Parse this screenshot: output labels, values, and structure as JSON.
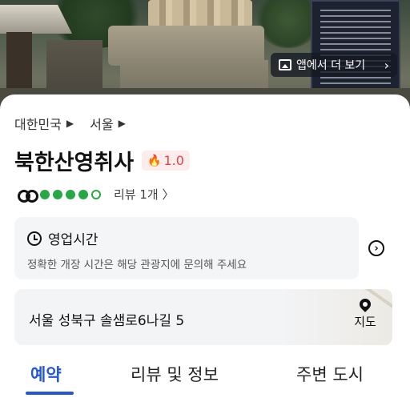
{
  "hero": {
    "app_button_label": "앱에서 더 보기",
    "app_button_chevron": "›"
  },
  "breadcrumb": {
    "items": [
      "대한민국",
      "서울"
    ],
    "separator": "▶"
  },
  "place": {
    "title": "북한산영취사",
    "hot_score": "1.0",
    "fire_icon": "🔥"
  },
  "rating": {
    "filled_bubbles": 4,
    "total_bubbles": 5,
    "accent_color": "#27a844",
    "review_label": "리뷰 1개 〉"
  },
  "hours": {
    "heading": "영업시간",
    "note": "정확한 개장 시간은 해당 관광지에 문의해 주세요",
    "arrow": "›"
  },
  "address": {
    "text": "서울 성북구 솔샘로6나길 5",
    "map_label": "지도"
  },
  "tabs": {
    "items": [
      {
        "label": "예약",
        "active": true
      },
      {
        "label": "리뷰 및 정보",
        "active": false
      },
      {
        "label": "주변 도시",
        "active": false
      }
    ],
    "active_color": "#2456d8"
  }
}
